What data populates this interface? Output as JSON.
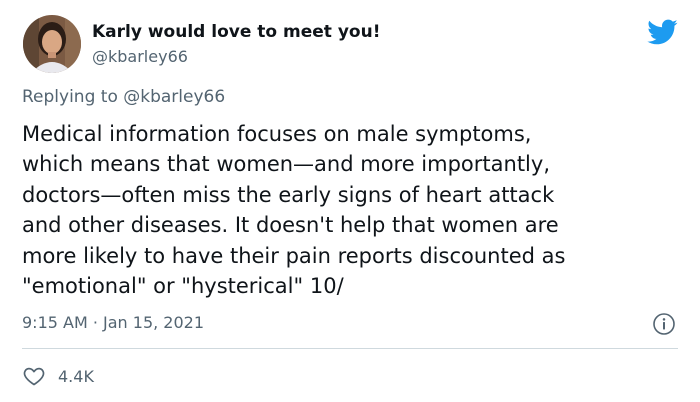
{
  "author": {
    "display_name": "Karly would love to meet you!",
    "handle": "@kbarley66"
  },
  "reply": {
    "prefix": "Replying to",
    "handle": "@kbarley66"
  },
  "tweet": {
    "lines": [
      "Medical information focuses on male symptoms,",
      "which means that women—and more importantly,",
      "doctors—often miss the early signs of heart attack",
      "and other diseases. It doesn't help that women are",
      "more likely to have their pain reports discounted as",
      "\"emotional\" or \"hysterical\" 10/"
    ],
    "timestamp": "9:15 AM · Jan 15, 2021"
  },
  "stats": {
    "likes": "4.4K"
  },
  "colors": {
    "brand": "#1d9bf0",
    "text": "#0f1419",
    "secondary": "#536471",
    "divider": "#cfd9de"
  },
  "icons": {
    "brand": "twitter-bird-icon",
    "info": "info-icon",
    "like": "heart-icon"
  }
}
